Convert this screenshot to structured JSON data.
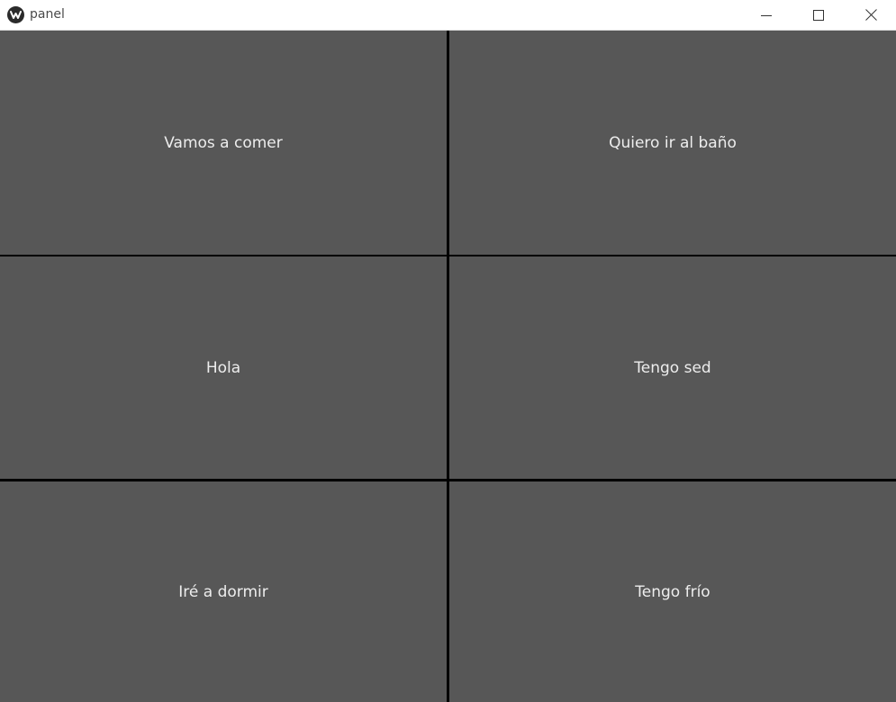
{
  "window": {
    "title": "panel",
    "app_icon": "kivy-logo-icon",
    "controls": {
      "minimize": "minimize-icon",
      "maximize": "maximize-icon",
      "close": "close-icon"
    }
  },
  "colors": {
    "titlebar_bg": "#ffffff",
    "button_bg": "#575757",
    "button_text": "#ededed",
    "separator": "#000000"
  },
  "buttons": [
    {
      "label": "Vamos a comer"
    },
    {
      "label": "Quiero ir al baño"
    },
    {
      "label": "Hola"
    },
    {
      "label": "Tengo sed"
    },
    {
      "label": "Iré a dormir"
    },
    {
      "label": "Tengo frío"
    }
  ]
}
